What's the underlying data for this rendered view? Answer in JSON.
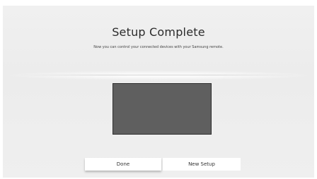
{
  "header": {
    "title": "Setup Complete",
    "subtitle": "Now you can control your connected devices with your Samsung remote."
  },
  "buttons": {
    "done_label": "Done",
    "new_setup_label": "New Setup"
  }
}
